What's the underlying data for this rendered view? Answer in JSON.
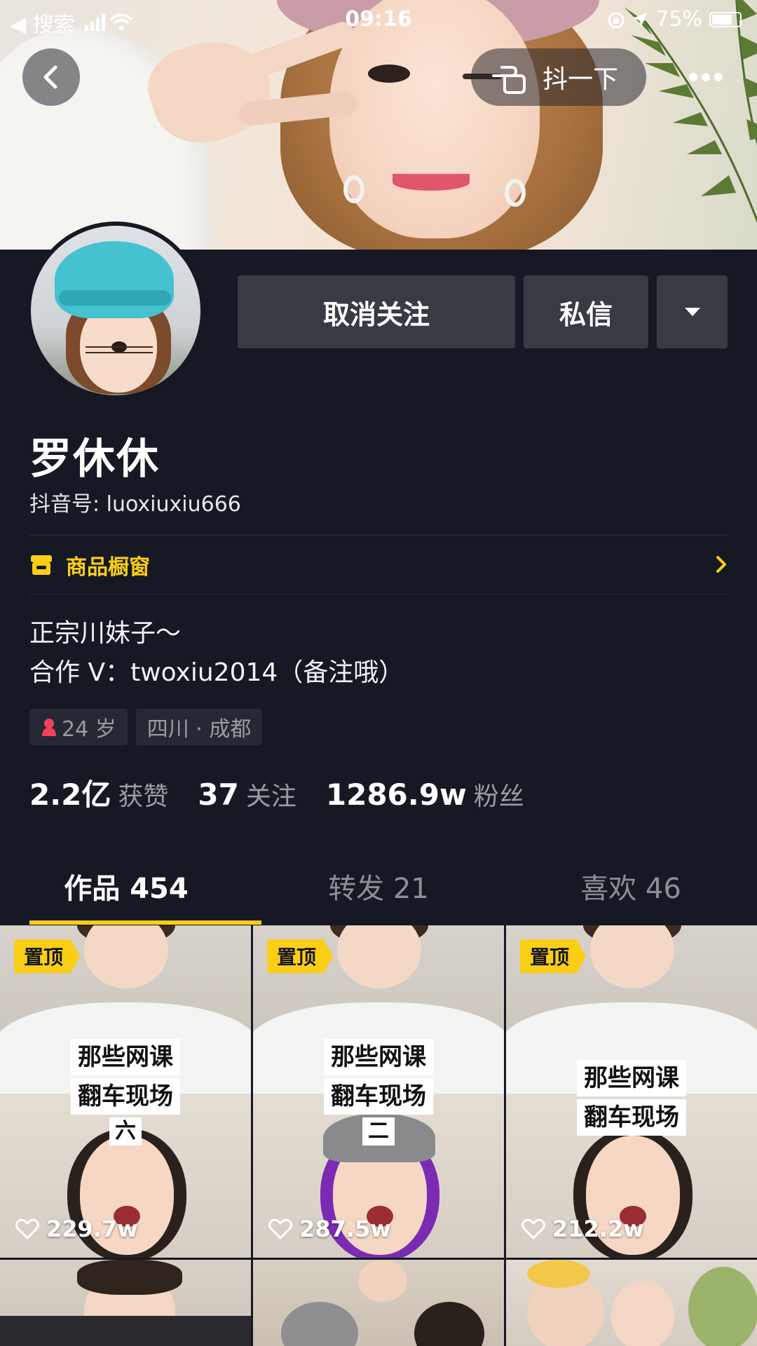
{
  "status_bar": {
    "back_app": "◀ 搜索",
    "time": "09:16",
    "battery": "75%"
  },
  "header": {
    "poke_label": "抖一下"
  },
  "actions": {
    "unfollow_label": "取消关注",
    "message_label": "私信"
  },
  "profile": {
    "nickname": "罗休休",
    "douyin_id": "抖音号: luoxiuxiu666",
    "shop_label": "商品橱窗",
    "bio_line1": "正宗川妹子～",
    "bio_line2": "合作 V：twoxiu2014（备注哦）",
    "tags": [
      {
        "label": "24 岁",
        "icon": "female-icon"
      },
      {
        "label": "四川 · 成都"
      }
    ]
  },
  "stats": [
    {
      "value": "2.2亿",
      "label": "获赞"
    },
    {
      "value": "37",
      "label": "关注"
    },
    {
      "value": "1286.9w",
      "label": "粉丝"
    }
  ],
  "tabs": [
    {
      "label": "作品 454",
      "active": true
    },
    {
      "label": "转发 21",
      "active": false
    },
    {
      "label": "喜欢 46",
      "active": false
    }
  ],
  "videos": [
    {
      "pinned": "置顶",
      "caption_line1": "那些网课",
      "caption_line2": "翻车现场",
      "caption_num": "六",
      "likes": "229.7w"
    },
    {
      "pinned": "置顶",
      "caption_line1": "那些网课",
      "caption_line2": "翻车现场",
      "caption_num": "二",
      "likes": "287.5w"
    },
    {
      "pinned": "置顶",
      "caption_line1": "那些网课",
      "caption_line2": "翻车现场",
      "caption_num": "",
      "likes": "212.2w"
    }
  ],
  "colors": {
    "background": "#161823",
    "accent_yellow": "#face15",
    "button_gray": "#393b44"
  }
}
